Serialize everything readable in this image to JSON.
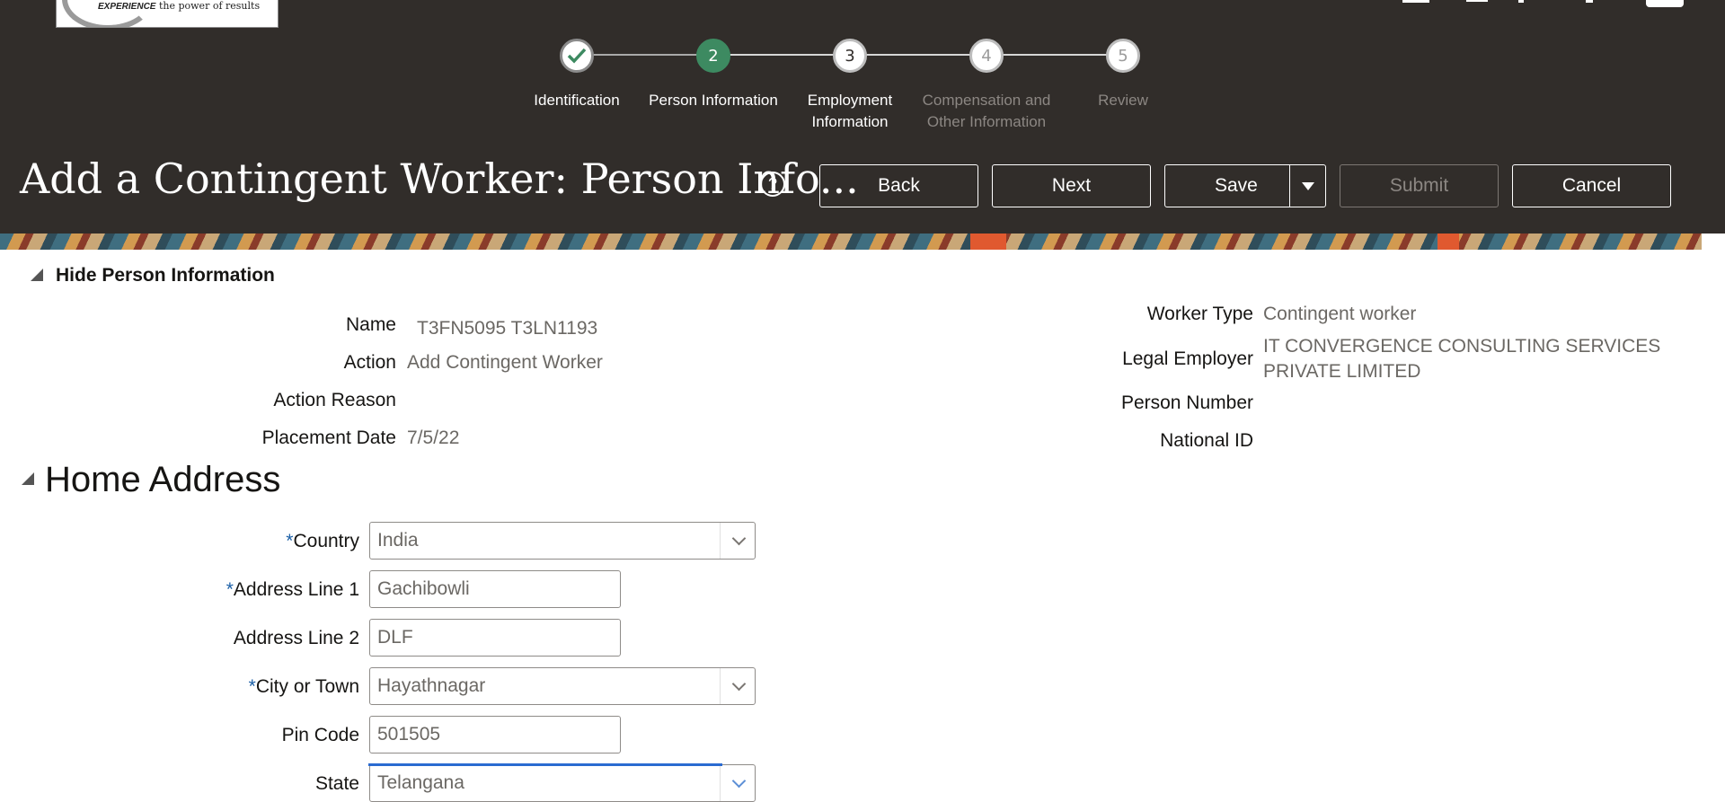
{
  "branding": {
    "logo_text_bold": "EXPERIENCE",
    "logo_text": "the power of results"
  },
  "train": {
    "steps": [
      {
        "number": "",
        "label": "Identification",
        "state": "visited"
      },
      {
        "number": "2",
        "label": "Person Information",
        "state": "current"
      },
      {
        "number": "3",
        "label": "Employment Information",
        "state": "next"
      },
      {
        "number": "4",
        "label": "Compensation and Other Information",
        "state": "disabled"
      },
      {
        "number": "5",
        "label": "Review",
        "state": "disabled"
      }
    ]
  },
  "page": {
    "title": "Add a Contingent Worker: Person Info...",
    "help_icon": "question-circle-icon"
  },
  "toolbar": {
    "back_label": "Back",
    "next_label": "Next",
    "save_label": "Save",
    "submit_label": "Submit",
    "cancel_label": "Cancel"
  },
  "person_info": {
    "section_label": "Hide Person Information",
    "left": [
      {
        "label": "Name",
        "value": "T3FN5095 T3LN1193"
      },
      {
        "label": "Action",
        "value": "Add Contingent Worker"
      },
      {
        "label": "Action Reason",
        "value": ""
      },
      {
        "label": "Placement Date",
        "value": "7/5/22"
      }
    ],
    "right": [
      {
        "label": "Worker Type",
        "value": "Contingent worker"
      },
      {
        "label": "Legal Employer",
        "value_line1": "IT CONVERGENCE CONSULTING SERVICES",
        "value_line2": "PRIVATE LIMITED"
      },
      {
        "label": "Person Number",
        "value": ""
      },
      {
        "label": "National ID",
        "value": ""
      }
    ]
  },
  "home_address": {
    "section_label": "Home Address",
    "required_marker": "*",
    "fields": [
      {
        "label": "Country",
        "value": "India",
        "required": true,
        "type": "select"
      },
      {
        "label": "Address Line 1",
        "value": "Gachibowli",
        "required": true,
        "type": "text"
      },
      {
        "label": "Address Line 2",
        "value": "DLF",
        "required": false,
        "type": "text"
      },
      {
        "label": "City or Town",
        "value": "Hayathnagar",
        "required": true,
        "type": "select"
      },
      {
        "label": "Pin Code",
        "value": "501505",
        "required": false,
        "type": "text"
      },
      {
        "label": "State",
        "value": "Telangana",
        "required": false,
        "type": "select"
      }
    ]
  },
  "colors": {
    "header_bg": "#312d2a",
    "current_step": "#3d8a61",
    "required_marker": "#1b5fa6",
    "focus_border": "#2a6bd1"
  }
}
